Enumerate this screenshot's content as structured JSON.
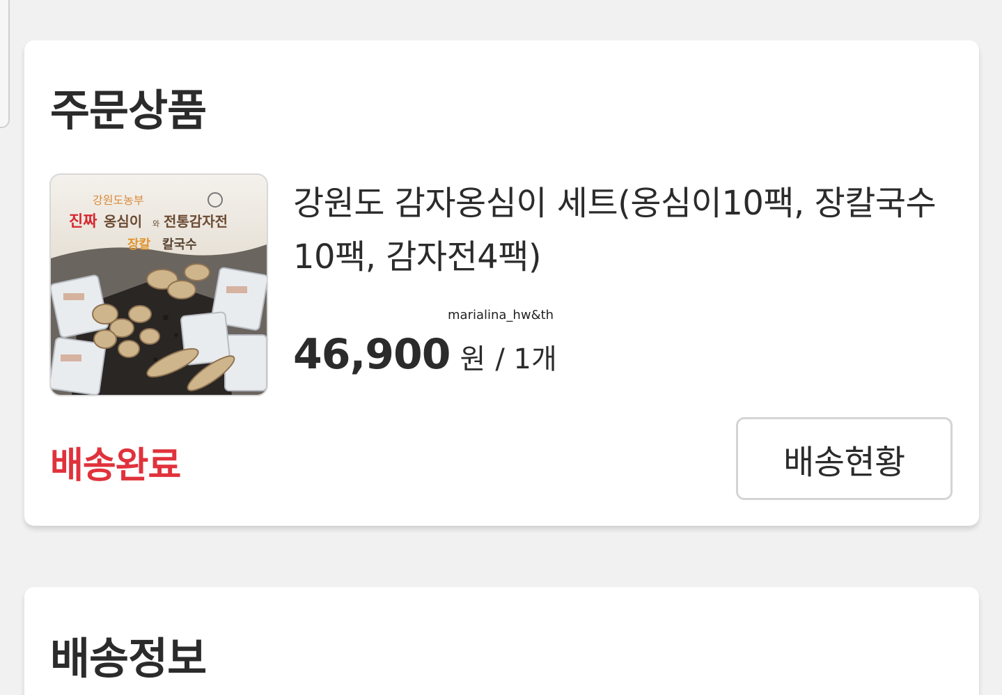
{
  "order_card": {
    "title": "주문상품",
    "product": {
      "name": "강원도 감자옹심이 세트(옹심이10팩, 장칼국수10팩, 감자전4팩)",
      "image_alt": "감자옹심이 세트 상품 이미지",
      "image_text": {
        "brand": "강원도농부",
        "headline_red": "진짜",
        "headline_1": "옹심이",
        "headline_join": "와",
        "headline_2": "전통감자전",
        "sub_red": "장칼",
        "sub": "칼국수"
      },
      "price": "46,900",
      "currency": "원",
      "quantity": "/ 1개"
    },
    "watermark": "marialina_hw&th",
    "status": "배송완료",
    "track_button_label": "배송현황"
  },
  "shipping_card": {
    "title": "배송정보"
  },
  "colors": {
    "background": "#f1f1f1",
    "card": "#ffffff",
    "status_red": "#e0323c",
    "text": "#2b2b2b",
    "border": "#d4d4d4"
  }
}
